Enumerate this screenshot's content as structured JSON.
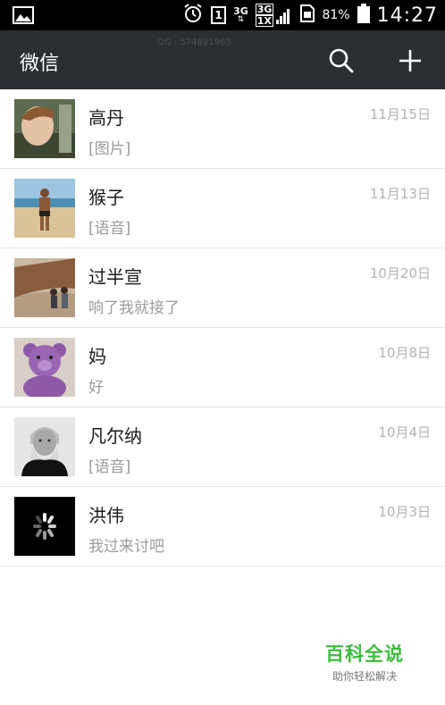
{
  "status_bar": {
    "sim_slot": "1",
    "net_3g_top": "3G",
    "net_3g": "3G",
    "net_1x": "1X",
    "battery_percent": "81%",
    "time": "14:27"
  },
  "header": {
    "title": "微信",
    "watermark": "QQ : 574891963"
  },
  "chats": [
    {
      "name": "高丹",
      "preview": "[图片]",
      "time": "11月15日"
    },
    {
      "name": "猴子",
      "preview": "[语音]",
      "time": "11月13日"
    },
    {
      "name": "过半宣",
      "preview": "响了我就接了",
      "time": "10月20日"
    },
    {
      "name": "妈",
      "preview": "好",
      "time": "10月8日"
    },
    {
      "name": "凡尔纳",
      "preview": "[语音]",
      "time": "10月4日"
    },
    {
      "name": "洪伟",
      "preview": "我过来讨吧",
      "time": "10月3日"
    }
  ],
  "brand": {
    "title": "百科全说",
    "subtitle": "助你轻松解决"
  },
  "icons": {
    "gallery": "image-icon",
    "alarm": "alarm-clock-icon",
    "search": "search-icon",
    "add": "plus-icon",
    "battery": "battery-icon"
  },
  "colors": {
    "header_bg": "#2b2f34",
    "status_bg": "#000000",
    "brand_green": "#3cbc3c"
  }
}
